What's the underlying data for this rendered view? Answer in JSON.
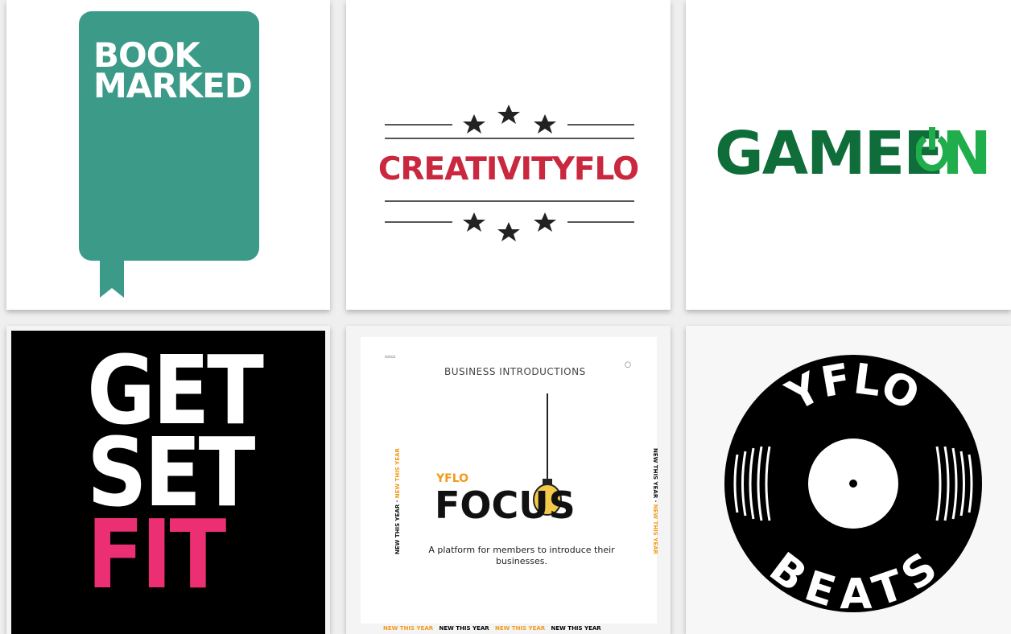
{
  "cards": {
    "bookmarked": {
      "line1": "BOOK",
      "line2": "MARKED",
      "color": "#3c9a88"
    },
    "creativityflo": {
      "title": "CREATIVITYFLO",
      "color": "#c9283f"
    },
    "gameon": {
      "text_main": "GAME",
      "text_o": "O",
      "text_n": "N",
      "dark": "#0f6d3a",
      "light": "#1fae4b"
    },
    "getsetfit": {
      "line1": "GET",
      "line2": "SET",
      "line3": "FIT",
      "accent": "#ec2f72"
    },
    "yflofocus": {
      "header": "BUSINESS INTRODUCTIONS",
      "small_brand": "YFLO",
      "title": "FOCUS",
      "description": "A platform for members to introduce their businesses.",
      "strip_dark": "NEW THIS YEAR",
      "strip_light": "NEW THIS YEAR",
      "accent": "#f29a1b"
    },
    "yflobeats": {
      "top": "YFLO",
      "bottom": "BEATS"
    }
  }
}
